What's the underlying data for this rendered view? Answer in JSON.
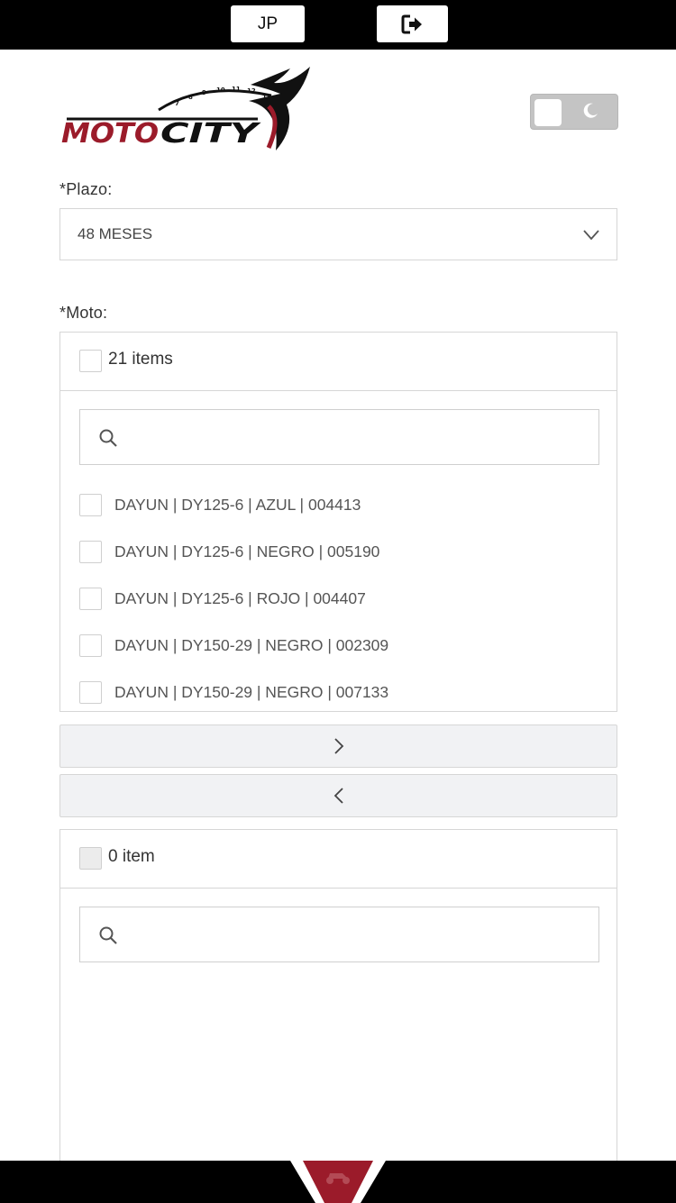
{
  "topbar": {
    "user_initials": "JP",
    "logout_icon": "logout-icon"
  },
  "brand": {
    "name": "MOTOCITY",
    "accent_color": "#9b1b2a"
  },
  "theme_toggle": {
    "state": "light",
    "icon": "moon-icon"
  },
  "form": {
    "plazo": {
      "label": "*Plazo:",
      "value": "48 MESES"
    },
    "moto": {
      "label": "*Moto:"
    }
  },
  "transfer": {
    "source": {
      "count_label": "21 items",
      "search_placeholder": "",
      "items": [
        "DAYUN | DY125-6 | AZUL | 004413",
        "DAYUN | DY125-6 | NEGRO | 005190",
        "DAYUN | DY125-6 | ROJO | 004407",
        "DAYUN | DY150-29 | NEGRO | 002309",
        "DAYUN | DY150-29 | NEGRO | 007133"
      ]
    },
    "move_right_icon": "chevron-right-icon",
    "move_left_icon": "chevron-left-icon",
    "target": {
      "count_label": "0 item",
      "search_placeholder": "",
      "items": []
    }
  }
}
